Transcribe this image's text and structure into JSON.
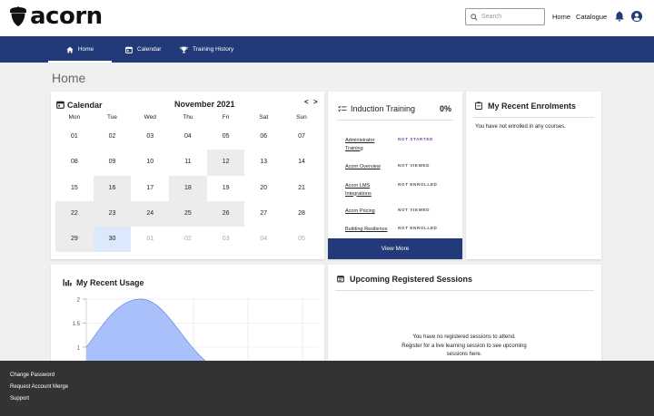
{
  "brand": {
    "name": "acorn"
  },
  "search": {
    "placeholder": "Search"
  },
  "header_links": {
    "home": "Home",
    "catalogue": "Catalogue"
  },
  "icons": {
    "bell": "bell-icon",
    "account": "account-circle-icon",
    "search": "search-icon"
  },
  "nav": {
    "items": [
      {
        "label": "Home",
        "icon": "home-icon",
        "active": true
      },
      {
        "label": "Calendar",
        "icon": "calendar-icon",
        "active": false
      },
      {
        "label": "Training History",
        "icon": "trophy-icon",
        "active": false
      }
    ]
  },
  "page": {
    "title": "Home"
  },
  "calendar": {
    "title": "Calendar",
    "month": "November 2021",
    "prev": "<",
    "next": ">",
    "weekdays": [
      "Mon",
      "Tue",
      "Wed",
      "Thu",
      "Fri",
      "Sat",
      "Sun"
    ],
    "weeks": [
      [
        "01",
        "02",
        "03",
        "04",
        "05",
        "06",
        "07"
      ],
      [
        "08",
        "09",
        "10",
        "11",
        "12",
        "13",
        "14"
      ],
      [
        "15",
        "16",
        "17",
        "18",
        "19",
        "20",
        "21"
      ],
      [
        "22",
        "23",
        "24",
        "25",
        "26",
        "27",
        "28"
      ],
      [
        "29",
        "30",
        "01",
        "02",
        "03",
        "04",
        "05"
      ]
    ]
  },
  "induction": {
    "title": "Induction Training",
    "percent": "0%",
    "items": [
      {
        "name": "Administrator Training",
        "status": "NOT STARTED"
      },
      {
        "name": "Acorn Overview",
        "status": "NOT VIEWED"
      },
      {
        "name": "Acorn LMS Integrations",
        "status": "NOT ENROLLED"
      },
      {
        "name": "Acorn Pricing",
        "status": "NOT VIEWED"
      },
      {
        "name": "Building Resilience",
        "status": "NOT ENROLLED"
      }
    ],
    "view_more": "View More"
  },
  "enrolments": {
    "title": "My Recent Enrolments",
    "empty": "You have not enrolled in any courses."
  },
  "usage": {
    "title": "My Recent Usage",
    "y_ticks": [
      "2",
      "1.5",
      "1"
    ],
    "fill_color": "#a9c0fb",
    "line_color": "#6f8fe6"
  },
  "sessions": {
    "title": "Upcoming Registered Sessions",
    "line1": "You have no registered sessions to attend.",
    "line2": "Register for a live learning session to see upcoming",
    "line3": "sessions here."
  },
  "footer": {
    "links": [
      "Change Password",
      "Request Account Merge",
      "Support"
    ]
  },
  "colors": {
    "nav_bg": "#223a7a",
    "footer_bg": "#333333",
    "today_bg": "#dce8fb",
    "not_started": "#7b3fb5"
  }
}
